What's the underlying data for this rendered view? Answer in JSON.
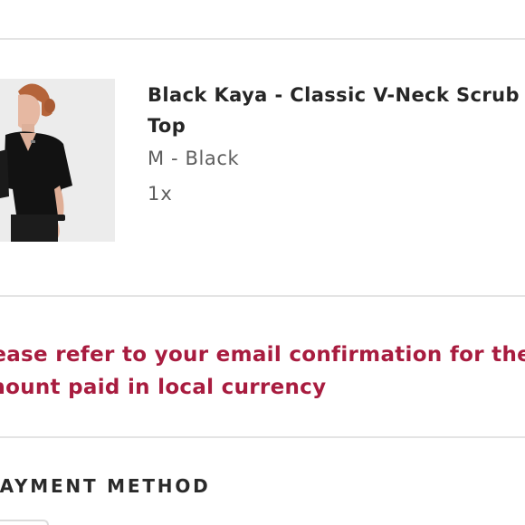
{
  "order_item": {
    "image_alt": "Woman wearing a black v-neck scrub top",
    "name": "Black Kaya - Classic V-Neck Scrub Top",
    "variant": "M - Black",
    "quantity": "1x"
  },
  "notice": {
    "text": "Please refer to your email confirmation for the amount paid in local currency",
    "color": "#a81c3f"
  },
  "payment": {
    "heading": "PAYMENT METHOD"
  }
}
